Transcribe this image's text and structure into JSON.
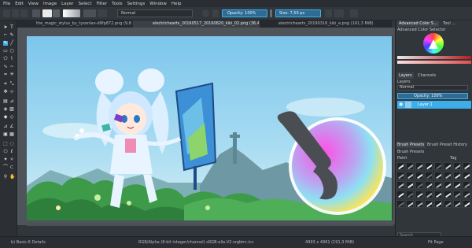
{
  "menu": [
    "File",
    "Edit",
    "View",
    "Image",
    "Layer",
    "Select",
    "Filter",
    "Tools",
    "Settings",
    "Window",
    "Help"
  ],
  "toolbar": {
    "blend_mode": "Normal",
    "opacity": "Opacity: 100%",
    "size": "Size: 7,50 px"
  },
  "tabs": [
    {
      "label": "the_magic_stylus_by_tysonlan-d9fp872.png (9,8 MiB)",
      "active": false
    },
    {
      "label": "electrichearts_20160517_20160820_kiki_02.png (36,4 MiB)",
      "active": true
    },
    {
      "label": "electrichearts_20190316_kiki_a.png (191,3 MiB)",
      "active": false
    }
  ],
  "dock": {
    "top_tabs": [
      "Advanced Color S...",
      "Tool ..."
    ],
    "color_selector_title": "Advanced Color Selector",
    "layers_tabs": [
      "Layers",
      "Channels"
    ],
    "layers_title": "Layers",
    "blend_mode": "Normal",
    "opacity": "Opacity: 100%",
    "layer_name": "Layer 1",
    "brush_tabs": [
      "Brush Presets",
      "Brush Preset History"
    ],
    "brush_title": "Brush Presets",
    "paint_label": "Paint",
    "tag_label": "Tag",
    "search_placeholder": "Search"
  },
  "status": {
    "brush": "b) Basic-6 Details",
    "color": "RGB/Alpha (8-bit integer/channel)  sRGB-elle-V2-srgbtrc.icc",
    "dims": "4993 x 4961 (191,3 MiB)",
    "fit": "Fit Page"
  },
  "colors": {
    "accent": "#3daee9",
    "bg": "#31363b",
    "sky": "#8fcdee"
  }
}
